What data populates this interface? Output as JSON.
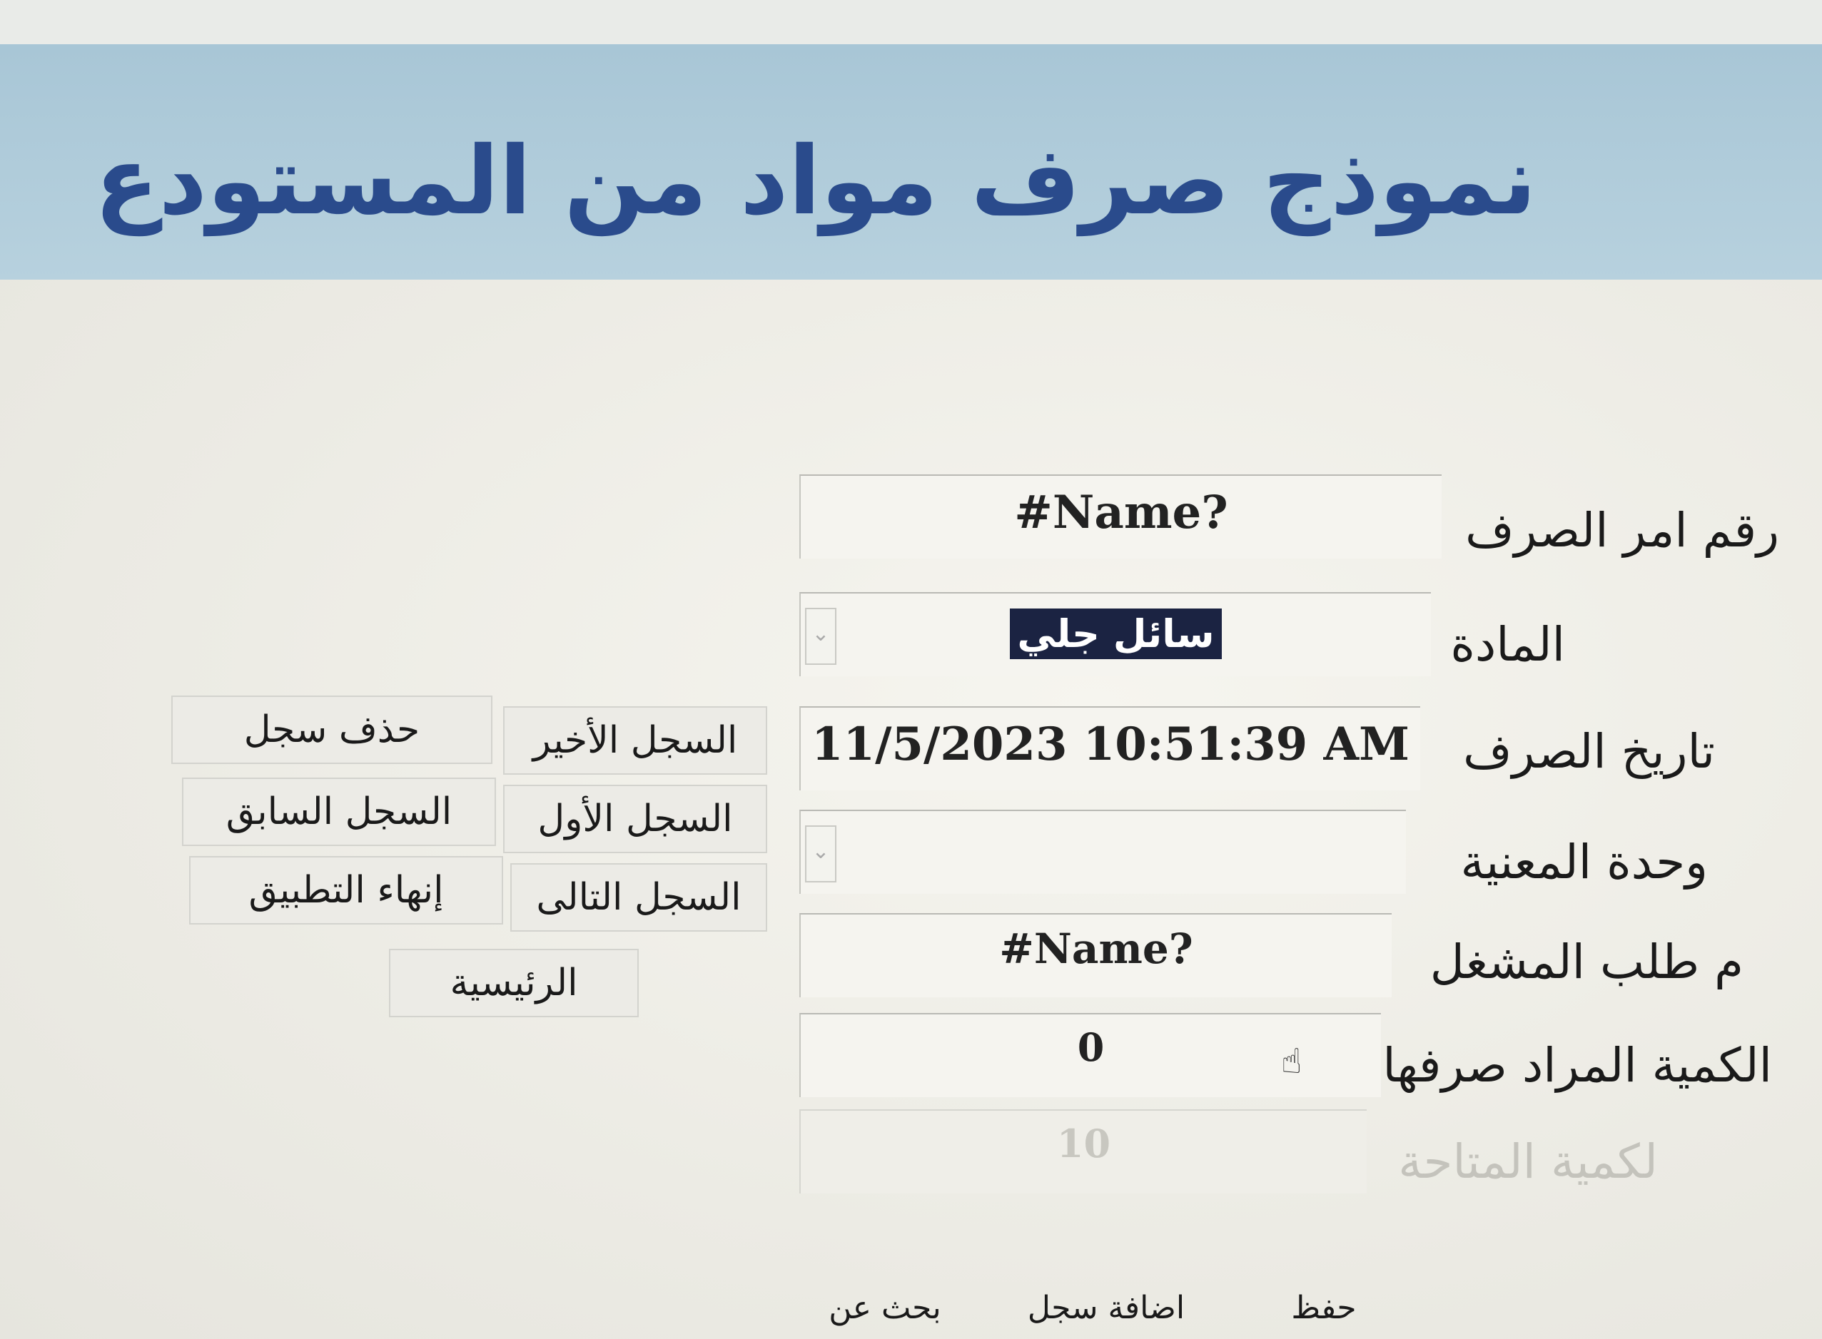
{
  "form": {
    "title": "نموذج صرف مواد من المستودع"
  },
  "fields": [
    {
      "label": "رقم امر الصرف",
      "value": "#Name?"
    },
    {
      "label": "المادة",
      "value": "سائل جلي"
    },
    {
      "label": "تاريخ الصرف",
      "value": "11/5/2023 10:51:39 AM"
    },
    {
      "label": "وحدة المعنية",
      "value": ""
    },
    {
      "label": "م طلب المشغل",
      "value": "#Name?"
    },
    {
      "label": "الكمية المراد صرفها",
      "value": "0"
    },
    {
      "label": "لكمية المتاحة",
      "value": "10"
    }
  ],
  "nav_buttons": {
    "last_record": "السجل الأخير",
    "delete_record": "حذف سجل",
    "first_record": "السجل الأول",
    "previous_record": "السجل السابق",
    "next_record": "السجل التالى",
    "exit_app": "إنهاء التطبيق",
    "home": "الرئيسية"
  },
  "bottom_buttons": {
    "save": "حفظ",
    "add_record": "اضافة سجل",
    "search": "بحث عن"
  },
  "icons": {
    "dropdown": "chevron-down-icon",
    "cursor": "hand-cursor-icon"
  },
  "colors": {
    "header_bg": "#b7d1de",
    "title_text": "#2a4b8c",
    "selection_bg": "#1b2342"
  }
}
